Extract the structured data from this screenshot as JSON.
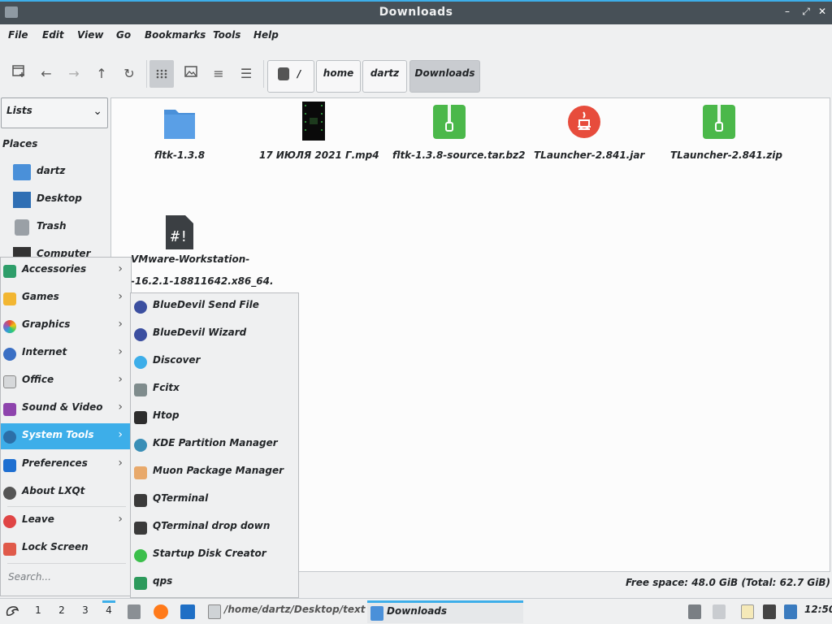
{
  "window": {
    "title": "Downloads",
    "minimize": "–",
    "maximize": "⤢",
    "close": "✕"
  },
  "menubar": [
    "File",
    "Edit",
    "View",
    "Go",
    "Bookmarks",
    "Tools",
    "Help"
  ],
  "breadcrumb": [
    "/",
    "home",
    "dartz",
    "Downloads"
  ],
  "sidebar": {
    "dropdown": "Lists",
    "places_header": "Places",
    "places": [
      "dartz",
      "Desktop",
      "Trash",
      "Computer"
    ]
  },
  "files": [
    {
      "name": "fltk-1.3.8",
      "icon": "folder-icon"
    },
    {
      "name": "17 ИЮЛЯ 2021 Г.mp4",
      "icon": "video-file-icon"
    },
    {
      "name": "fltk-1.3.8-source.tar.bz2",
      "icon": "archive-icon"
    },
    {
      "name": "TLauncher-2.841.jar",
      "icon": "java-icon"
    },
    {
      "name": "TLauncher-2.841.zip",
      "icon": "archive-icon"
    },
    {
      "name_line1": "VMware-Workstation-",
      "name_line2": "-16.2.1-18811642.x86_64.",
      "icon": "script-file-icon"
    }
  ],
  "status": {
    "free_space": "Free space: 48.0 GiB (Total: 62.7 GiB)"
  },
  "start_menu": {
    "items": [
      "Accessories",
      "Games",
      "Graphics",
      "Internet",
      "Office",
      "Sound & Video",
      "System Tools",
      "Preferences",
      "About LXQt",
      "Leave",
      "Lock Screen"
    ],
    "selected": "System Tools",
    "search_placeholder": "Search..."
  },
  "submenu": {
    "items": [
      "BlueDevil Send File",
      "BlueDevil Wizard",
      "Discover",
      "Fcitx",
      "Htop",
      "KDE Partition Manager",
      "Muon Package Manager",
      "QTerminal",
      "QTerminal drop down",
      "Startup Disk Creator",
      "qps"
    ]
  },
  "taskbar": {
    "desktops": [
      "1",
      "2",
      "3",
      "4"
    ],
    "active_desktop": "4",
    "tasks": [
      "/home/dartz/Desktop/text",
      "Downloads"
    ],
    "clock": "12:50"
  },
  "colors": {
    "accent": "#3daee9",
    "titlebar": "#475057",
    "archive_green": "#4bb84a",
    "java_red": "#e74c3c",
    "folder_blue": "#4a90d9"
  }
}
